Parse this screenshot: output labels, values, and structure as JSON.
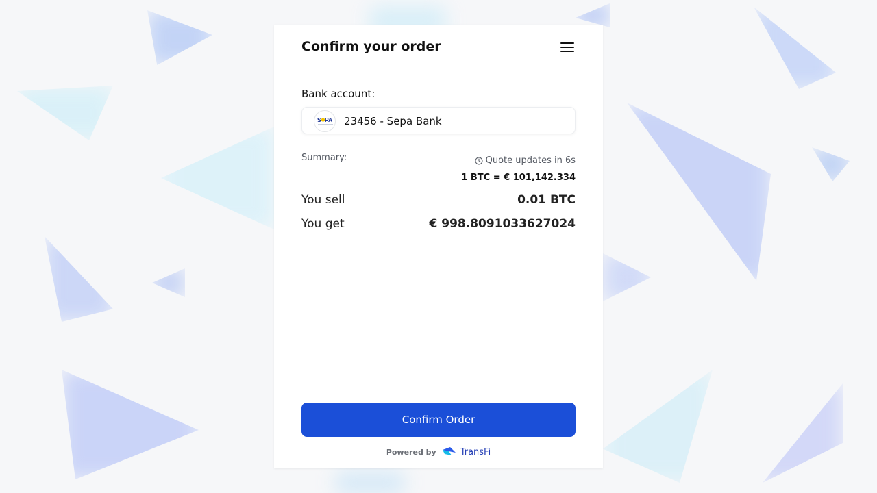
{
  "header": {
    "title": "Confirm your order",
    "menu_icon": "hamburger-menu-icon"
  },
  "bank": {
    "label": "Bank account:",
    "selected": "23456 - Sepa Bank",
    "logo_text": "SEPA",
    "logo_icon": "sepa-logo-icon"
  },
  "summary": {
    "label": "Summary:",
    "quote_timer": "Quote updates in 6s",
    "timer_icon": "clock-icon",
    "rate": "1 BTC = € 101,142.334",
    "rows": [
      {
        "label": "You sell",
        "value": "0.01 BTC"
      },
      {
        "label": "You get",
        "value": "€ 998.8091033627024"
      }
    ]
  },
  "actions": {
    "confirm_label": "Confirm Order"
  },
  "footer": {
    "powered_by": "Powered by",
    "brand_name": "TransFi",
    "brand_icon": "transfi-logo-icon"
  },
  "colors": {
    "primary": "#1b4fd8",
    "brand_text": "#2640b6",
    "text": "#111111",
    "muted": "#555a63",
    "background": "#f6f7f9"
  }
}
